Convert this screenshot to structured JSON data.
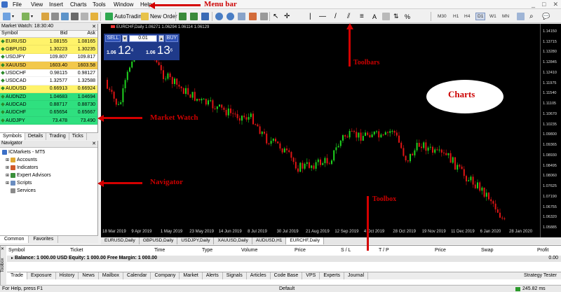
{
  "menu": {
    "items": [
      "File",
      "View",
      "Insert",
      "Charts",
      "Tools",
      "Window",
      "Help"
    ],
    "window_controls": [
      "_",
      "□",
      "✕"
    ]
  },
  "annotations": {
    "menu_bar": "Menu bar",
    "toolbars": "Toolbars",
    "charts": "Charts",
    "market_watch": "Market Watch",
    "navigator": "Navigator",
    "toolbox": "Toolbox"
  },
  "toolbar": {
    "autotrading": "AutoTrading",
    "new_order": "New Order",
    "timeframes": [
      "M30",
      "H1",
      "H4",
      "D1",
      "W1",
      "MN"
    ],
    "active_timeframe": "D1"
  },
  "market_watch": {
    "title": "Market Watch: 18:30:40",
    "columns": [
      "Symbol",
      "Bid",
      "Ask"
    ],
    "rows": [
      {
        "symbol": "EURUSD",
        "bid": "1.08155",
        "ask": "1.08165",
        "bg": "#fff36a"
      },
      {
        "symbol": "GBPUSD",
        "bid": "1.30223",
        "ask": "1.30235",
        "bg": "#fff36a"
      },
      {
        "symbol": "USDJPY",
        "bid": "109.807",
        "ask": "109.817",
        "bg": "#ffffff"
      },
      {
        "symbol": "XAUUSD",
        "bid": "1603.40",
        "ask": "1603.58",
        "bg": "#f2c84b"
      },
      {
        "symbol": "USDCHF",
        "bid": "0.98115",
        "ask": "0.98127",
        "bg": "#ffffff"
      },
      {
        "symbol": "USDCAD",
        "bid": "1.32577",
        "ask": "1.32588",
        "bg": "#ffffff"
      },
      {
        "symbol": "AUDUSD",
        "bid": "0.66913",
        "ask": "0.66924",
        "bg": "#fff36a"
      },
      {
        "symbol": "AUDNZD",
        "bid": "1.04683",
        "ask": "1.04694",
        "bg": "#2fe07f"
      },
      {
        "symbol": "AUDCAD",
        "bid": "0.88717",
        "ask": "0.88730",
        "bg": "#2fe07f"
      },
      {
        "symbol": "AUDCHF",
        "bid": "0.65654",
        "ask": "0.65667",
        "bg": "#2fe07f"
      },
      {
        "symbol": "AUDJPY",
        "bid": "73.478",
        "ask": "73.490",
        "bg": "#2fe07f"
      }
    ],
    "tabs": [
      "Symbols",
      "Details",
      "Trading",
      "Ticks"
    ],
    "active_tab": "Symbols"
  },
  "navigator": {
    "title": "Navigator",
    "root": "ICMarkets - MT5",
    "items": [
      "Accounts",
      "Indicators",
      "Expert Advisors",
      "Scripts",
      "Services"
    ],
    "tabs": [
      "Common",
      "Favorites"
    ],
    "active_tab": "Common"
  },
  "chart": {
    "header": "EURCHF,Daily 1.06271 1.06294 1.06114 1.06129",
    "one_click": {
      "sell": "SELL",
      "buy": "BUY",
      "lot": "0.01",
      "sell_price_small": "1.06",
      "sell_price_big": "12",
      "sell_price_sup": "4",
      "buy_price_small": "1.06",
      "buy_price_big": "13",
      "buy_price_sup": "6"
    },
    "price_ticks": [
      "1.14150",
      "1.13715",
      "1.13280",
      "1.12845",
      "1.12410",
      "1.11975",
      "1.11540",
      "1.11105",
      "1.10670",
      "1.10235",
      "1.09800",
      "1.09365",
      "1.08930",
      "1.08495",
      "1.08060",
      "1.07625",
      "1.07190",
      "1.06755",
      "1.06320",
      "1.05885"
    ],
    "time_ticks": [
      "18 Mar 2019",
      "9 Apr 2019",
      "1 May 2019",
      "23 May 2019",
      "14 Jun 2019",
      "8 Jul 2019",
      "30 Jul 2019",
      "21 Aug 2019",
      "12 Sep 2019",
      "4 Oct 2019",
      "28 Oct 2019",
      "19 Nov 2019",
      "11 Dec 2019",
      "6 Jan 2020",
      "28 Jan 2020"
    ],
    "tabs": [
      "EURUSD,Daily",
      "GBPUSD,Daily",
      "USDJPY,Daily",
      "XAUUSD,Daily",
      "AUDUSD,H1",
      "EURCHF,Daily"
    ],
    "active_tab": "EURCHF,Daily",
    "colors": {
      "up": "#1fd31f",
      "down": "#e01515",
      "background": "#000000"
    }
  },
  "toolbox": {
    "side_label": "Toolbox",
    "columns": [
      "Symbol",
      "Ticket",
      "Time",
      "Type",
      "Volume",
      "Price",
      "S / L",
      "T / P",
      "Price",
      "Swap",
      "Profit"
    ],
    "balance_line": "Balance: 1 000.00 USD  Equity: 1 000.00  Free Margin: 1 000.00",
    "balance_value": "0.00",
    "tabs": [
      "Trade",
      "Exposure",
      "History",
      "News",
      "Mailbox",
      "Calendar",
      "Company",
      "Market",
      "Alerts",
      "Signals",
      "Articles",
      "Code Base",
      "VPS",
      "Experts",
      "Journal"
    ],
    "active_tab": "Trade",
    "strategy_tester": "Strategy Tester"
  },
  "status": {
    "help": "For Help, press F1",
    "profile": "Default",
    "traffic": "245.82 ms"
  }
}
